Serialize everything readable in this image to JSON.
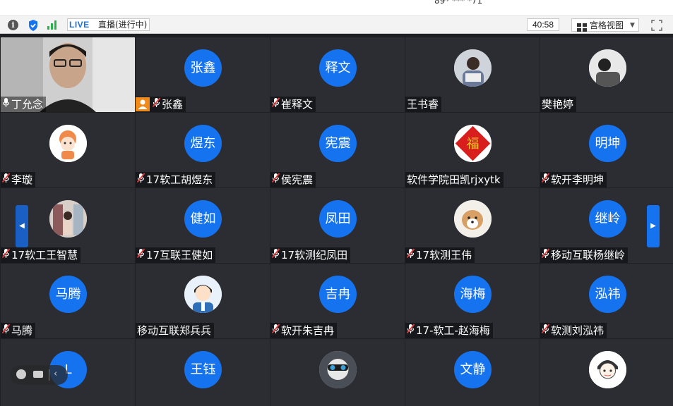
{
  "window": {
    "title": "89* *** *71"
  },
  "toolbar": {
    "live_badge": "LIVE",
    "live_status": "直播(进行中)",
    "timer": "40:58",
    "view_mode": "宫格视图",
    "icons": [
      "info-icon",
      "shield-icon",
      "signal-icon",
      "grid-icon",
      "chevron-down-icon",
      "fullscreen-icon"
    ]
  },
  "colors": {
    "accent": "#1673f0",
    "tile_bg": "#2b2d33",
    "grid_bg": "#1f2024",
    "camera_badge": "#f08a1a",
    "muted_mic": "#e03a3a"
  },
  "participants": [
    {
      "name": "丁允念",
      "kind": "camera",
      "mic": "on"
    },
    {
      "name": "张鑫",
      "avatar_text": "张鑫",
      "kind": "text",
      "mic": "muted",
      "host_badge": true
    },
    {
      "name": "崔释文",
      "avatar_text": "释文",
      "kind": "text",
      "mic": "muted"
    },
    {
      "name": "王书睿",
      "kind": "photo",
      "photo": "person",
      "mic": "none"
    },
    {
      "name": "樊艳婷",
      "kind": "photo",
      "photo": "bw",
      "mic": "none"
    },
    {
      "name": "李璇",
      "kind": "photo",
      "photo": "cartoon-bun",
      "mic": "muted"
    },
    {
      "name": "17软工胡煜东",
      "avatar_text": "煜东",
      "kind": "text",
      "mic": "muted"
    },
    {
      "name": "侯宪震",
      "avatar_text": "宪震",
      "kind": "text",
      "mic": "muted"
    },
    {
      "name": "软件学院田凯rjxytk",
      "kind": "photo",
      "photo": "fu",
      "mic": "none"
    },
    {
      "name": "软开李明坤",
      "avatar_text": "明坤",
      "kind": "text",
      "mic": "muted"
    },
    {
      "name": "17软工王智慧",
      "kind": "photo",
      "photo": "shop",
      "mic": "muted"
    },
    {
      "name": "17互联王健如",
      "avatar_text": "健如",
      "kind": "text",
      "mic": "muted"
    },
    {
      "name": "17软测纪凤田",
      "avatar_text": "凤田",
      "kind": "text",
      "mic": "muted"
    },
    {
      "name": "17软测王伟",
      "kind": "photo",
      "photo": "dog",
      "mic": "muted"
    },
    {
      "name": "移动互联杨继岭",
      "avatar_text": "继岭",
      "kind": "text",
      "mic": "muted"
    },
    {
      "name": "马腾",
      "avatar_text": "马腾",
      "kind": "text",
      "mic": "muted"
    },
    {
      "name": "移动互联郑兵兵",
      "kind": "photo",
      "photo": "cartoon-man",
      "mic": "none"
    },
    {
      "name": "软开朱吉冉",
      "avatar_text": "吉冉",
      "kind": "text",
      "mic": "muted"
    },
    {
      "name": "17-软工-赵海梅",
      "avatar_text": "海梅",
      "kind": "text",
      "mic": "muted"
    },
    {
      "name": "软测刘泓祎",
      "avatar_text": "泓祎",
      "kind": "text",
      "mic": "muted"
    },
    {
      "name": "",
      "avatar_text": "L",
      "kind": "text",
      "mic": "none"
    },
    {
      "name": "",
      "avatar_text": "王钰",
      "kind": "text",
      "mic": "none"
    },
    {
      "name": "",
      "kind": "photo",
      "photo": "goggles",
      "mic": "none"
    },
    {
      "name": "",
      "avatar_text": "文静",
      "kind": "text",
      "mic": "none"
    },
    {
      "name": "",
      "kind": "photo",
      "photo": "cartoon-boy",
      "mic": "none"
    }
  ]
}
